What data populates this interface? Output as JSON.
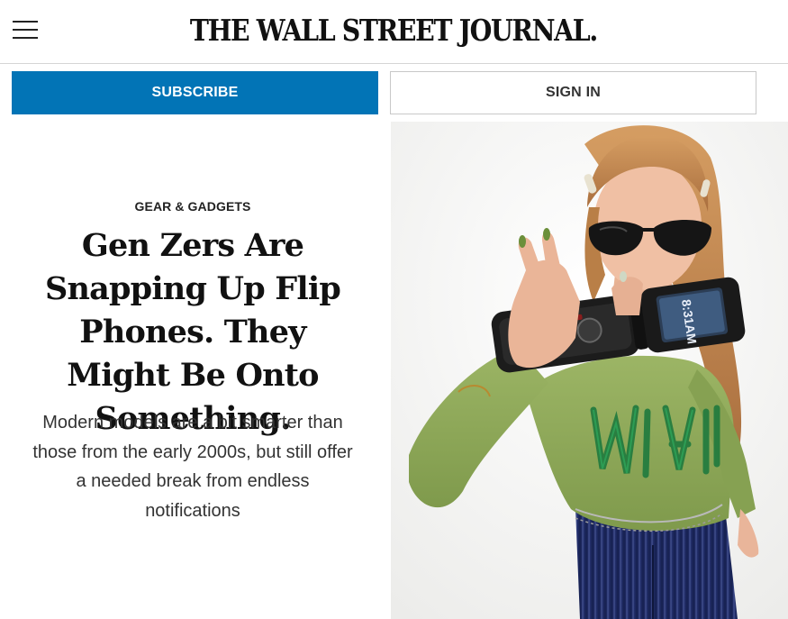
{
  "header": {
    "logo": "THE WALL STREET JOURNAL.",
    "menu_icon": "hamburger-menu-icon"
  },
  "actions": {
    "subscribe_label": "SUBSCRIBE",
    "signin_label": "SIGN IN"
  },
  "article": {
    "kicker": "GEAR & GADGETS",
    "headline": "Gen Zers Are Snapping Up Flip Phones. They Might Be Onto Something.",
    "dek": "Modern models are a bit smarter than those from the early 2000s, but still offer a needed break from endless notifications",
    "image": {
      "phone_screen_text": "8:31AM"
    }
  },
  "colors": {
    "subscribe_bg": "#0274b6",
    "shirt": "#8da757",
    "pants": "#1e2a63",
    "hair": "#c48a52"
  }
}
